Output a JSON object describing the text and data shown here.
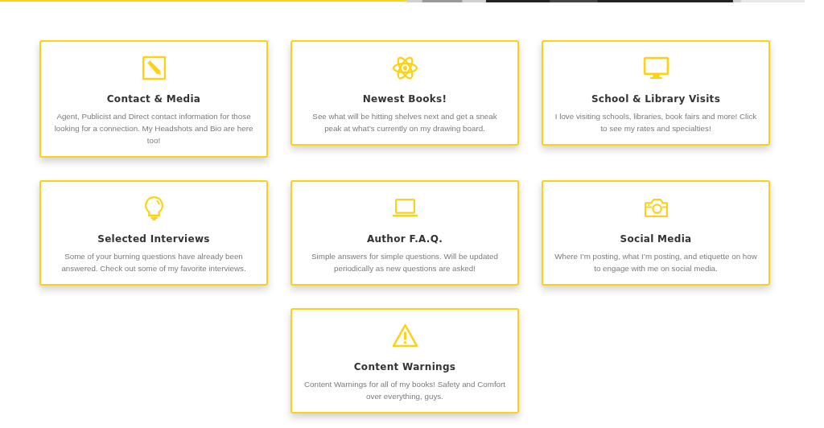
{
  "cards": [
    {
      "title": "Contact & Media",
      "description": "Agent, Publicist and Direct contact information for those looking for a connection. My Headshots and Bio are here too!"
    },
    {
      "title": "Newest Books!",
      "description": "See what will be hitting shelves next and get a sneak peak at what’s currently on my drawing board."
    },
    {
      "title": "School & Library Visits",
      "description": "I love visiting schools, libraries, book fairs and more! Click to see my rates and specialties!"
    },
    {
      "title": "Selected Interviews",
      "description": "Some of your burning questions have already been answered. Check out some of my favorite interviews."
    },
    {
      "title": "Author F.A.Q.",
      "description": "Simple answers for simple questions. Will be updated periodically as new questions are asked!"
    },
    {
      "title": "Social Media",
      "description": "Where I’m posting, what I’m posting, and etiquette on how to engage with me on social media."
    },
    {
      "title": "Content Warnings",
      "description": "Content Warnings for all of my books! Safety and Comfort over everything, guys."
    }
  ]
}
